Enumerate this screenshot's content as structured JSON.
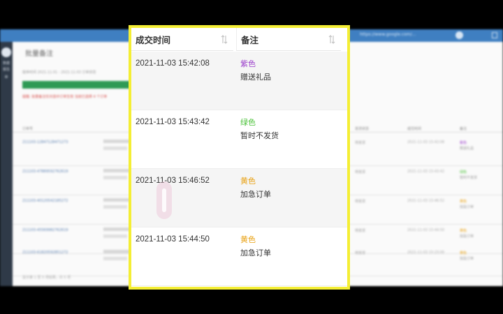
{
  "background_app": {
    "title": "批量备注",
    "url_text": "https://www.google.com/...",
    "side_items": [
      "数据",
      "报告",
      "单"
    ],
    "filter_text": "提单时间  2021.11.01 - 2021.11.03  订单状态",
    "warning_text": "提醒: 批量备注仅对选中订单生效 当前已选择 4 个订单",
    "table_headers": [
      "订单号",
      "发货状态",
      "成交时间",
      "备注"
    ],
    "rows": [
      {
        "order_id": "211103-12847128471273",
        "status": "待发货",
        "time": "2021-11-03 15:42:08",
        "color": "紫色",
        "color_hex": "#9b3fcb",
        "note": "赠送礼品"
      },
      {
        "order_id": "211103-47889592762619",
        "status": "待发货",
        "time": "2021-11-03 15:43:42",
        "color": "绿色",
        "color_hex": "#4cc23a",
        "note": "暂时不发货"
      },
      {
        "order_id": "211103-40120542185272",
        "status": "待发货",
        "time": "2021-11-03 15:46:52",
        "color": "黄色",
        "color_hex": "#e8a113",
        "note": "加急订单"
      },
      {
        "order_id": "211103-45569982762619",
        "status": "待发货",
        "time": "2021-11-03 15:44:50",
        "color": "黄色",
        "color_hex": "#e8a113",
        "note": "加急订单"
      },
      {
        "order_id": "211103-61820592851272",
        "status": "待发货",
        "time": "2021-11-03 15:23:00",
        "color": "黄色",
        "color_hex": "#e8a113",
        "note": "加急订单"
      }
    ],
    "footer_text": "显示第 1 至 5 项结果，共 5 项"
  },
  "panel": {
    "highlight_color": "#f4ee34",
    "headers": {
      "time": "成交时间",
      "note": "备注"
    },
    "rows": [
      {
        "time": "2021-11-03 15:42:08",
        "color": "紫色",
        "color_hex": "#9b3fcb",
        "note": "赠送礼品"
      },
      {
        "time": "2021-11-03 15:43:42",
        "color": "绿色",
        "color_hex": "#4cc23a",
        "note": "暂时不发货"
      },
      {
        "time": "2021-11-03 15:46:52",
        "color": "黄色",
        "color_hex": "#e8a113",
        "note": "加急订单"
      },
      {
        "time": "2021-11-03 15:44:50",
        "color": "黄色",
        "color_hex": "#e8a113",
        "note": "加急订单"
      }
    ]
  }
}
